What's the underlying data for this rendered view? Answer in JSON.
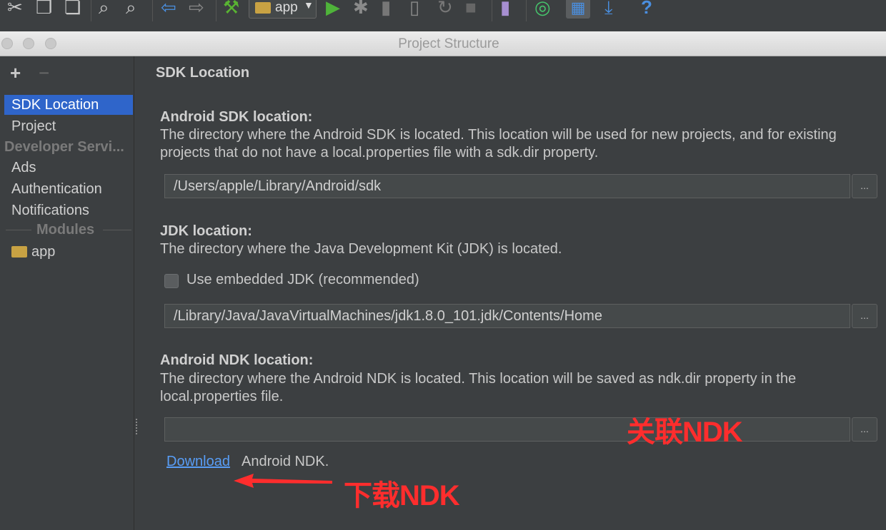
{
  "toolbar": {
    "config_label": "app",
    "help_label": "?"
  },
  "dialog": {
    "title": "Project Structure"
  },
  "sidebar": {
    "add": "+",
    "remove": "−",
    "items": {
      "sdk_location": "SDK Location",
      "project": "Project",
      "developer_services": "Developer Servi...",
      "ads": "Ads",
      "authentication": "Authentication",
      "notifications": "Notifications",
      "modules": "Modules",
      "app": "app"
    }
  },
  "main": {
    "heading": "SDK Location",
    "android_sdk": {
      "title": "Android SDK location:",
      "description": "The directory where the Android SDK is located. This location will be used for new projects, and for existing projects that do not have a local.properties file with a sdk.dir property.",
      "path": "/Users/apple/Library/Android/sdk",
      "browse": "..."
    },
    "jdk": {
      "title": "JDK location:",
      "description": "The directory where the Java Development Kit (JDK) is located.",
      "embedded_label": "Use embedded JDK (recommended)",
      "path": "/Library/Java/JavaVirtualMachines/jdk1.8.0_101.jdk/Contents/Home",
      "browse": "..."
    },
    "ndk": {
      "title": "Android NDK location:",
      "description": "The directory where the Android NDK is located. This location will be saved as ndk.dir property in the local.properties file.",
      "path": "",
      "browse": "...",
      "download_link": "Download",
      "download_text": "Android NDK."
    }
  },
  "annotations": {
    "link_ndk": "关联NDK",
    "download_ndk": "下载NDK"
  },
  "colors": {
    "background": "#3c3f41",
    "selection": "#2f65ca",
    "link": "#589df6",
    "annotation": "#ff2d2d"
  }
}
